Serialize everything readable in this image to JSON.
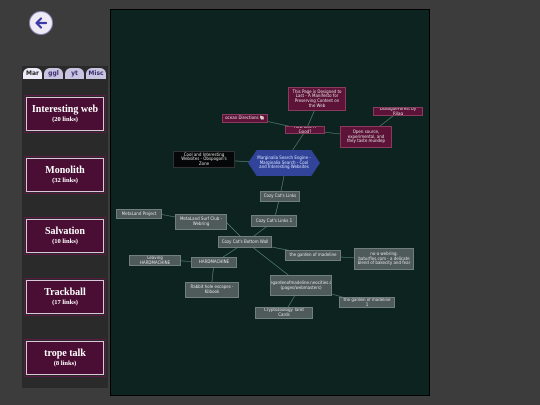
{
  "tabs": [
    "Mar",
    "ggl",
    "yt",
    "Misc"
  ],
  "collections": [
    {
      "name": "Interesting web",
      "count": "(20 links)"
    },
    {
      "name": "Monolith",
      "count": "(32 links)"
    },
    {
      "name": "Salvation",
      "count": "(10 links)"
    },
    {
      "name": "Trackball",
      "count": "(17 links)"
    },
    {
      "name": "trope talk",
      "count": "(8 links)"
    }
  ],
  "graph": {
    "center": "Marginalia Search Engine - Marginalia Search - Cool and Interesting Websites",
    "nodes": {
      "preserving": "This Page is Designed to Last - A Manifesto for Preserving Content on the Web",
      "dialogue_forest": "DialogueForest by Rilag",
      "ocean_directions": "ocean Directions 🐚",
      "how_like_good": "How Like A Good?",
      "open_source": "Open source, experimental, and they taste mundep",
      "cool_websites": "Cool and Interesting Websites - Obspogon's Zone",
      "cozy_links": "Cozy Cat's Links",
      "cozy_links_1": "Cozy Cat's Links 1",
      "metaland_project": "MetaLand Project",
      "metaland_surf": "MetaLand Surf Club - Webring",
      "cozy_bottom": "Cozy Cat's Bottom Wall",
      "garden": "the garden of madeline",
      "webring": "no-a webring. baturfles.com - a delicate blend of bakecity and fear",
      "leaving": "Leaving HARDMACHINE",
      "hardmachine": "HARDMACHINE",
      "thegardenof": "thegardenofmadeline.neocities.org (pages/webmasters)",
      "rabbit_hole": "Rabbit hole escapes - Kiibook",
      "garden_1": "the garden of madeline 1",
      "cryptozoology": "Cryptozoology Tarot Cards"
    }
  },
  "colors": {
    "accent": "#4a0e34",
    "canvas_bg": "#0d2320",
    "hex": "#31449a"
  },
  "icons": {
    "back": "back-arrow-icon"
  }
}
